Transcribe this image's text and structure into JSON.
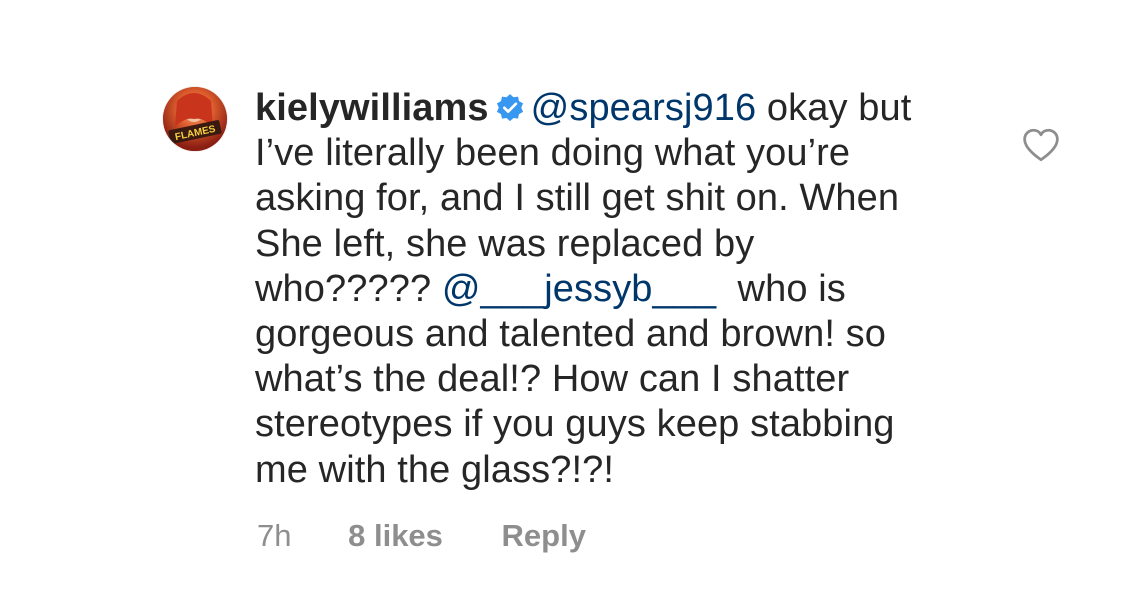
{
  "comment": {
    "username": "kielywilliams",
    "verified_icon": "verified-badge-icon",
    "avatar_icon": "avatar",
    "avatar_text": "FLAMES",
    "lines": [
      {
        "mention": "@spearsj916",
        "text": " okay but"
      },
      {
        "text": "I’ve literally been doing what you’re"
      },
      {
        "text": "asking for, and I still get shit on. When"
      },
      {
        "text": "She left, she was replaced by"
      },
      {
        "pre": "who????? ",
        "mention": "@___jessyb___",
        "text": "  who is"
      },
      {
        "text": "gorgeous and talented and brown! so"
      },
      {
        "text": "what’s the deal!? How can I shatter"
      },
      {
        "text": "stereotypes if you guys keep stabbing"
      },
      {
        "text": "me with the glass?!?!"
      }
    ],
    "meta": {
      "time": "7h",
      "likes": "8 likes",
      "reply": "Reply"
    },
    "like_icon": "heart-icon"
  },
  "colors": {
    "text": "#262626",
    "mention": "#00376b",
    "secondary": "#8e8e8e",
    "verified": "#3897f0"
  }
}
